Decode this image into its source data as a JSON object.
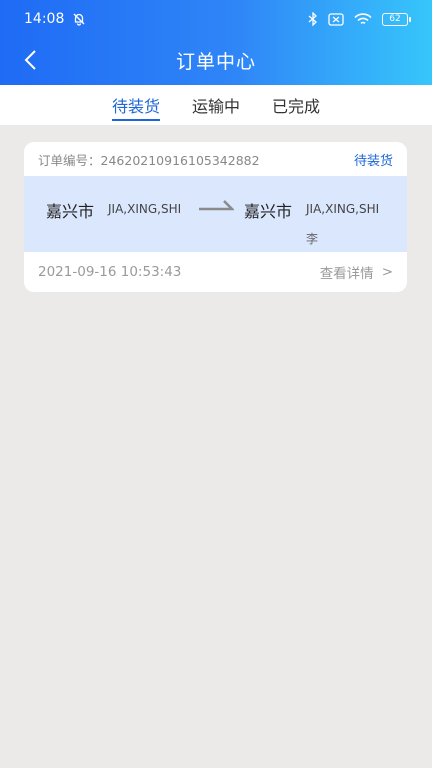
{
  "status_bar": {
    "time": "14:08",
    "battery": "62"
  },
  "header": {
    "title": "订单中心"
  },
  "tabs": [
    {
      "label": "待装货",
      "active": true
    },
    {
      "label": "运输中",
      "active": false
    },
    {
      "label": "已完成",
      "active": false
    }
  ],
  "order": {
    "number_label": "订单编号：",
    "number": "24620210916105342882",
    "status": "待装货",
    "origin_city": "嘉兴市",
    "origin_pinyin": "JIA,XING,SHI",
    "dest_city": "嘉兴市",
    "dest_pinyin": "JIA,XING,SHI",
    "contact": "李",
    "datetime": "2021-09-16 10:53:43",
    "detail_label": "查看详情",
    "detail_arrow": ">"
  },
  "colors": {
    "accent": "#1e66d8",
    "header_start": "#1f6bf5",
    "header_end": "#37c6fb",
    "route_bg": "#dbe7fd"
  }
}
